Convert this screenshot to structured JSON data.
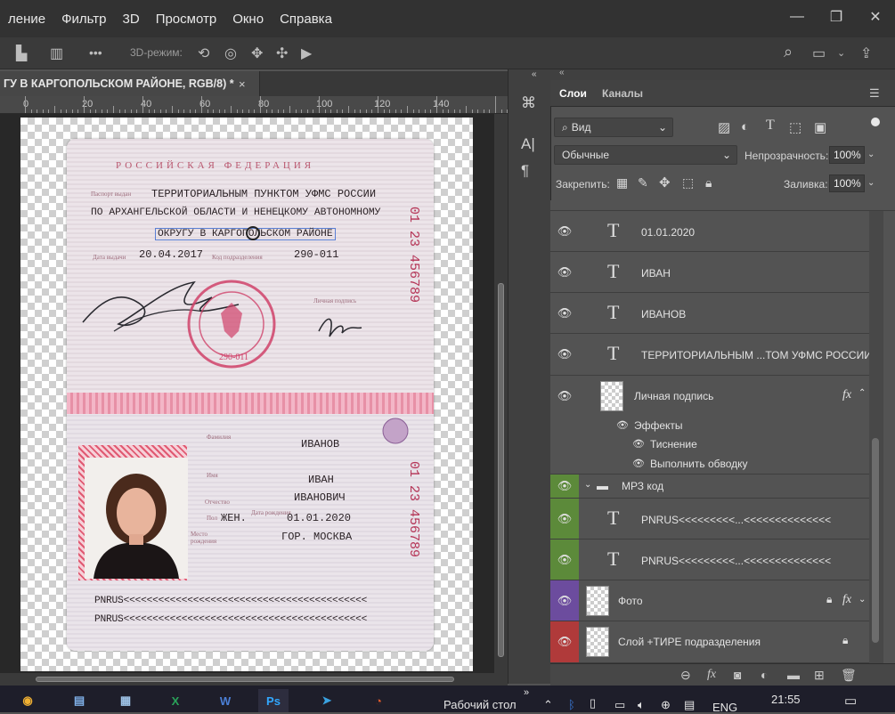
{
  "menu": [
    "ление",
    "Фильтр",
    "3D",
    "Просмотр",
    "Окно",
    "Справка"
  ],
  "options_bar": {
    "mode_3d_label": "3D-режим:",
    "more": "•••"
  },
  "document": {
    "tab_title": "ГУ В КАРГОПОЛЬСКОМ РАЙОНЕ, RGB/8) *",
    "close": "×"
  },
  "ruler": {
    "labels": [
      "0",
      "20",
      "40",
      "60",
      "80",
      "100",
      "120",
      "140"
    ]
  },
  "passport": {
    "header": "РОССИЙСКАЯ ФЕДЕРАЦИЯ",
    "issued_label": "Паспорт выдан",
    "issuer_line1": "ТЕРРИТОРИАЛЬНЫМ ПУНКТОМ УФМС РОССИИ",
    "issuer_line2": "ПО АРХАНГЕЛЬСКОЙ ОБЛАСТИ И НЕНЕЦКОМУ АВТОНОМНОМУ",
    "issuer_line3": "ОКРУГУ В КАРГОПОЛЬСКОМ РАЙОНЕ",
    "date_label": "Дата выдачи",
    "date": "20.04.2017",
    "code_label": "Код подразделения",
    "code": "290-011",
    "signature_label": "Личная подпись",
    "stamp_text": "290-011",
    "series_top": "01  23  456789",
    "series_bottom": "01  23  456789",
    "surname_label": "Фамилия",
    "surname": "ИВАНОВ",
    "name_label": "Имя",
    "name": "ИВАН",
    "patronymic_label": "Отчество",
    "patronymic": "ИВАНОВИЧ",
    "sex_label": "Пол",
    "sex": "ЖЕН.",
    "dob_label": "Дата рождения",
    "dob": "01.01.2020",
    "birthplace_label": "Место рождения",
    "birthplace": "ГОР. МОСКВА",
    "mrz1": "PNRUS<<<<<<<<<<<<<<<<<<<<<<<<<<<<<<<<<<<<<<<<<<",
    "mrz2": "PNRUS<<<<<<<<<<<<<<<<<<<<<<<<<<<<<<<<<<<<<<<<<<"
  },
  "panel": {
    "tab_layers": "Слои",
    "tab_channels": "Каналы",
    "search": "Вид",
    "blend_mode": "Обычные",
    "opacity_label": "Непрозрачность:",
    "opacity": "100%",
    "lock_label": "Закрепить:",
    "fill_label": "Заливка:",
    "fill": "100%"
  },
  "layers": [
    {
      "name": "01.01.2020",
      "kind": "text"
    },
    {
      "name": "ИВАН",
      "kind": "text"
    },
    {
      "name": "ИВАНОВ",
      "kind": "text"
    },
    {
      "name": "ТЕРРИТОРИАЛЬНЫМ ...ТОМ УФМС РОССИИ",
      "kind": "text"
    },
    {
      "name": "Личная подпись",
      "kind": "smart",
      "fx": "fx"
    },
    {
      "name": "Эффекты",
      "kind": "effects"
    },
    {
      "name": "Тиснение",
      "kind": "effect"
    },
    {
      "name": "Выполнить обводку",
      "kind": "effect"
    },
    {
      "name": "МРЗ код",
      "kind": "group",
      "color": "#5c8a3a"
    },
    {
      "name": "PNRUS<<<<<<<<<...<<<<<<<<<<<<<<",
      "kind": "text",
      "color": "#5c8a3a"
    },
    {
      "name": "PNRUS<<<<<<<<<...<<<<<<<<<<<<<<",
      "kind": "text",
      "color": "#5c8a3a"
    },
    {
      "name": "Фото",
      "kind": "smart",
      "color": "#6c4c9e",
      "fx": "fx"
    },
    {
      "name": "Слой +ТИРЕ подразделения",
      "kind": "raster",
      "color": "#b03a3a"
    }
  ],
  "taskbar": {
    "desktop": "Рабочий стол",
    "lang": "ENG",
    "time": "21:55"
  }
}
